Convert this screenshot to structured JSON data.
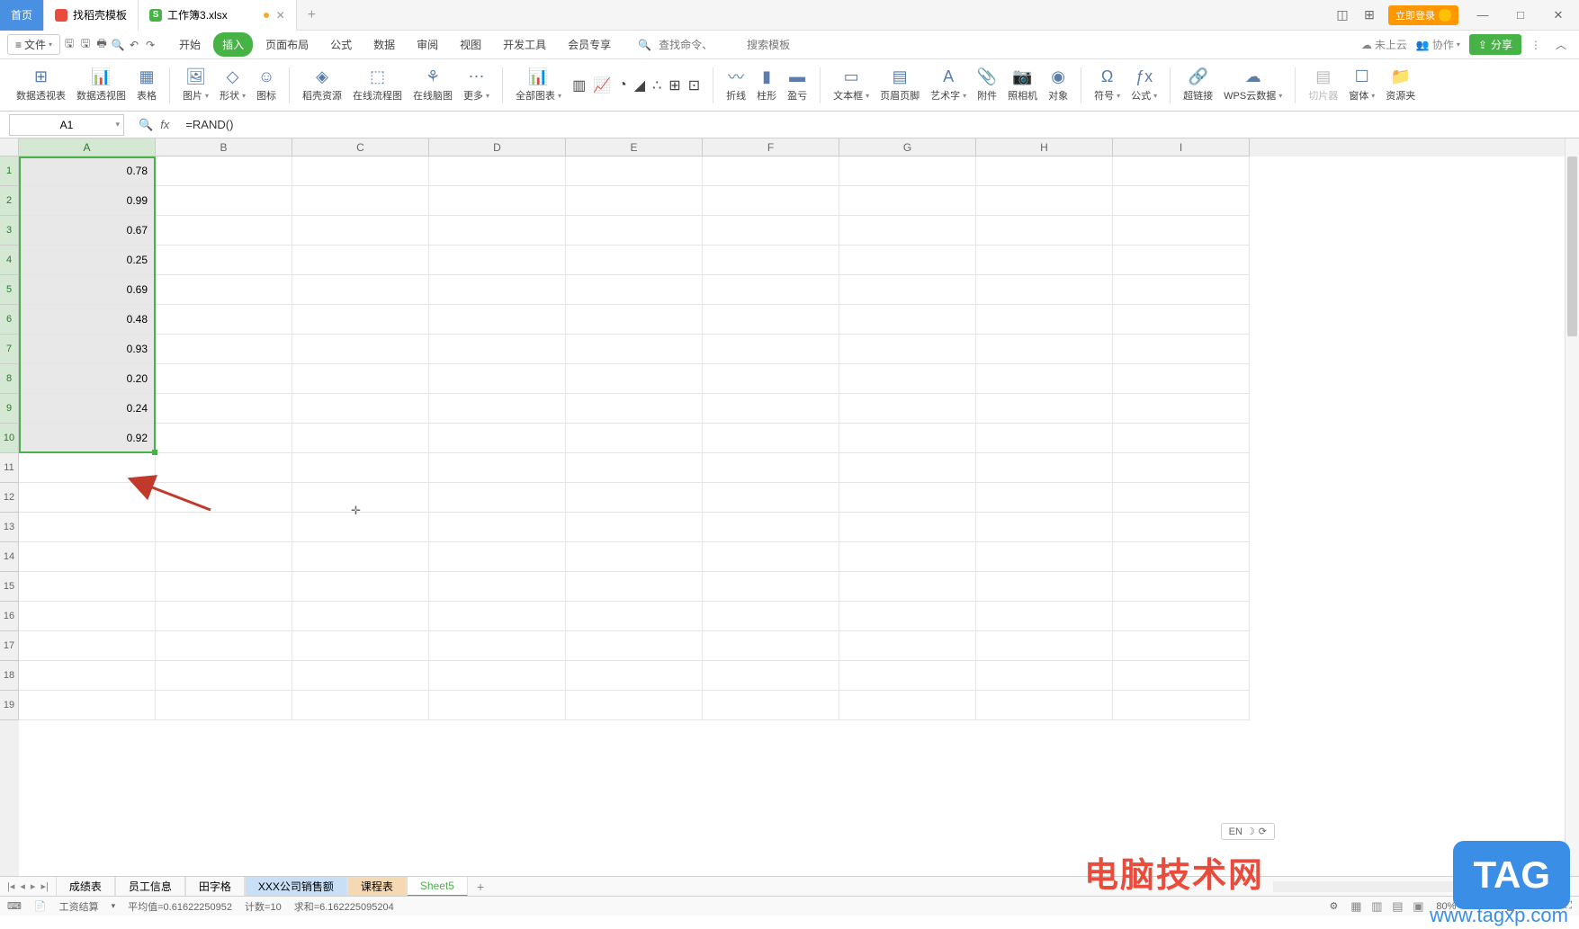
{
  "titleBar": {
    "homeTab": "首页",
    "templateTab": "找稻壳模板",
    "fileTab": "工作簿3.xlsx",
    "loginBtn": "立即登录"
  },
  "menuBar": {
    "fileMenu": "文件",
    "tabs": [
      "开始",
      "插入",
      "页面布局",
      "公式",
      "数据",
      "审阅",
      "视图",
      "开发工具",
      "会员专享"
    ],
    "activeTab": "插入",
    "searchPlaceholder1": "查找命令、",
    "searchPlaceholder2": "搜索模板",
    "notUploaded": "未上云",
    "collab": "协作",
    "share": "分享"
  },
  "ribbon": {
    "pivotTable": "数据透视表",
    "pivotChart": "数据透视图",
    "table": "表格",
    "picture": "图片",
    "shapes": "形状",
    "icons": "图标",
    "docerRes": "稻壳资源",
    "onlineFlow": "在线流程图",
    "onlineMind": "在线脑图",
    "more": "更多",
    "allCharts": "全部图表",
    "line": "折线",
    "column": "柱形",
    "winLoss": "盈亏",
    "textBox": "文本框",
    "headerFooter": "页眉页脚",
    "wordArt": "艺术字",
    "attachment": "附件",
    "camera": "照相机",
    "object": "对象",
    "symbol": "符号",
    "equation": "公式",
    "hyperlink": "超链接",
    "wpsCloud": "WPS云数据",
    "slicer": "切片器",
    "form": "窗体",
    "resourceFolder": "资源夹"
  },
  "formulaBar": {
    "nameBox": "A1",
    "formula": "=RAND()"
  },
  "grid": {
    "columns": [
      "A",
      "B",
      "C",
      "D",
      "E",
      "F",
      "G",
      "H",
      "I"
    ],
    "rows": [
      1,
      2,
      3,
      4,
      5,
      6,
      7,
      8,
      9,
      10,
      11,
      12,
      13,
      14,
      15,
      16,
      17,
      18,
      19
    ],
    "selectedRows": [
      1,
      2,
      3,
      4,
      5,
      6,
      7,
      8,
      9,
      10
    ],
    "data": [
      "0.78",
      "0.99",
      "0.67",
      "0.25",
      "0.69",
      "0.48",
      "0.93",
      "0.20",
      "0.24",
      "0.92"
    ]
  },
  "sheetTabs": {
    "tabs": [
      "成绩表",
      "员工信息",
      "田字格",
      "XXX公司销售额",
      "课程表",
      "Sheet5"
    ],
    "active": "Sheet5"
  },
  "statusBar": {
    "label": "工资结算",
    "avg": "平均值=0.61622250952",
    "count": "计数=10",
    "sum": "求和=6.162225095204",
    "ime": "EN",
    "zoom": "80%"
  },
  "watermarks": {
    "w1": "电脑技术网",
    "w2": "TAG",
    "w3": "www.tagxp.com"
  }
}
